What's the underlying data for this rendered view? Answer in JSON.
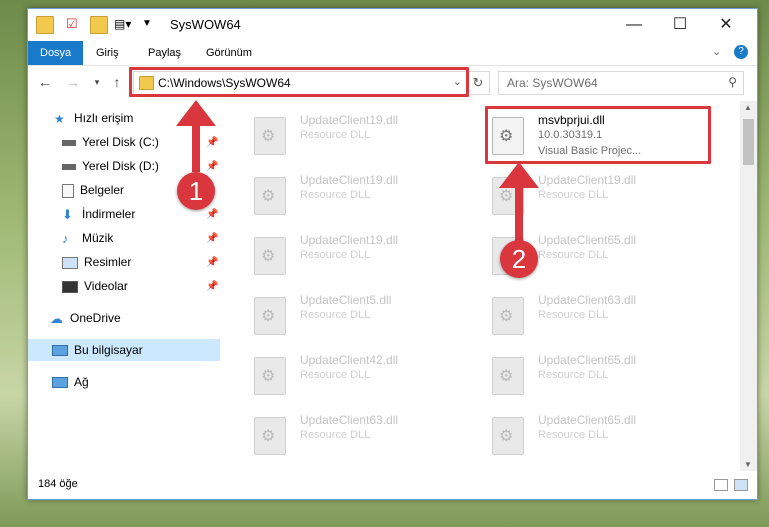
{
  "window": {
    "title": "SysWOW64"
  },
  "ribbon": {
    "tabs": [
      "Dosya",
      "Giriş",
      "Paylaş",
      "Görünüm"
    ]
  },
  "address": {
    "path": "C:\\Windows\\SysWOW64"
  },
  "search": {
    "placeholder": "Ara: SysWOW64"
  },
  "sidebar": {
    "quick_access": "Hızlı erişim",
    "items": [
      "Yerel Disk (C:)",
      "Yerel Disk (D:)",
      "Belgeler",
      "İndirmeler",
      "Müzik",
      "Resimler",
      "Videolar"
    ],
    "onedrive": "OneDrive",
    "this_pc": "Bu bilgisayar",
    "network": "Ağ"
  },
  "files": {
    "selected": {
      "name": "msvbprjui.dll",
      "version": "10.0.30319.1",
      "description": "Visual Basic Projec..."
    },
    "left": [
      {
        "name": "UpdateClient19.dll",
        "desc": "Resource DLL"
      },
      {
        "name": "UpdateClient19.dll",
        "desc": "Resource DLL"
      },
      {
        "name": "UpdateClient19.dll",
        "desc": "Resource DLL"
      },
      {
        "name": "UpdateClient5.dll",
        "desc": "Resource DLL"
      },
      {
        "name": "UpdateClient42.dll",
        "desc": "Resource DLL"
      },
      {
        "name": "UpdateClient63.dll",
        "desc": "Resource DLL"
      }
    ],
    "right": [
      {
        "name": "UpdateClient19.dll",
        "desc": "Resource DLL"
      },
      {
        "name": "UpdateClient65.dll",
        "desc": "Resource DLL"
      },
      {
        "name": "UpdateClient63.dll",
        "desc": "Resource DLL"
      },
      {
        "name": "UpdateClient65.dll",
        "desc": "Resource DLL"
      },
      {
        "name": "UpdateClient65.dll",
        "desc": "Resource DLL"
      }
    ]
  },
  "status": {
    "count": "184 öğe"
  },
  "annotations": {
    "one": "1",
    "two": "2"
  },
  "colors": {
    "accent": "#1979ca",
    "highlight": "#d9363e"
  }
}
